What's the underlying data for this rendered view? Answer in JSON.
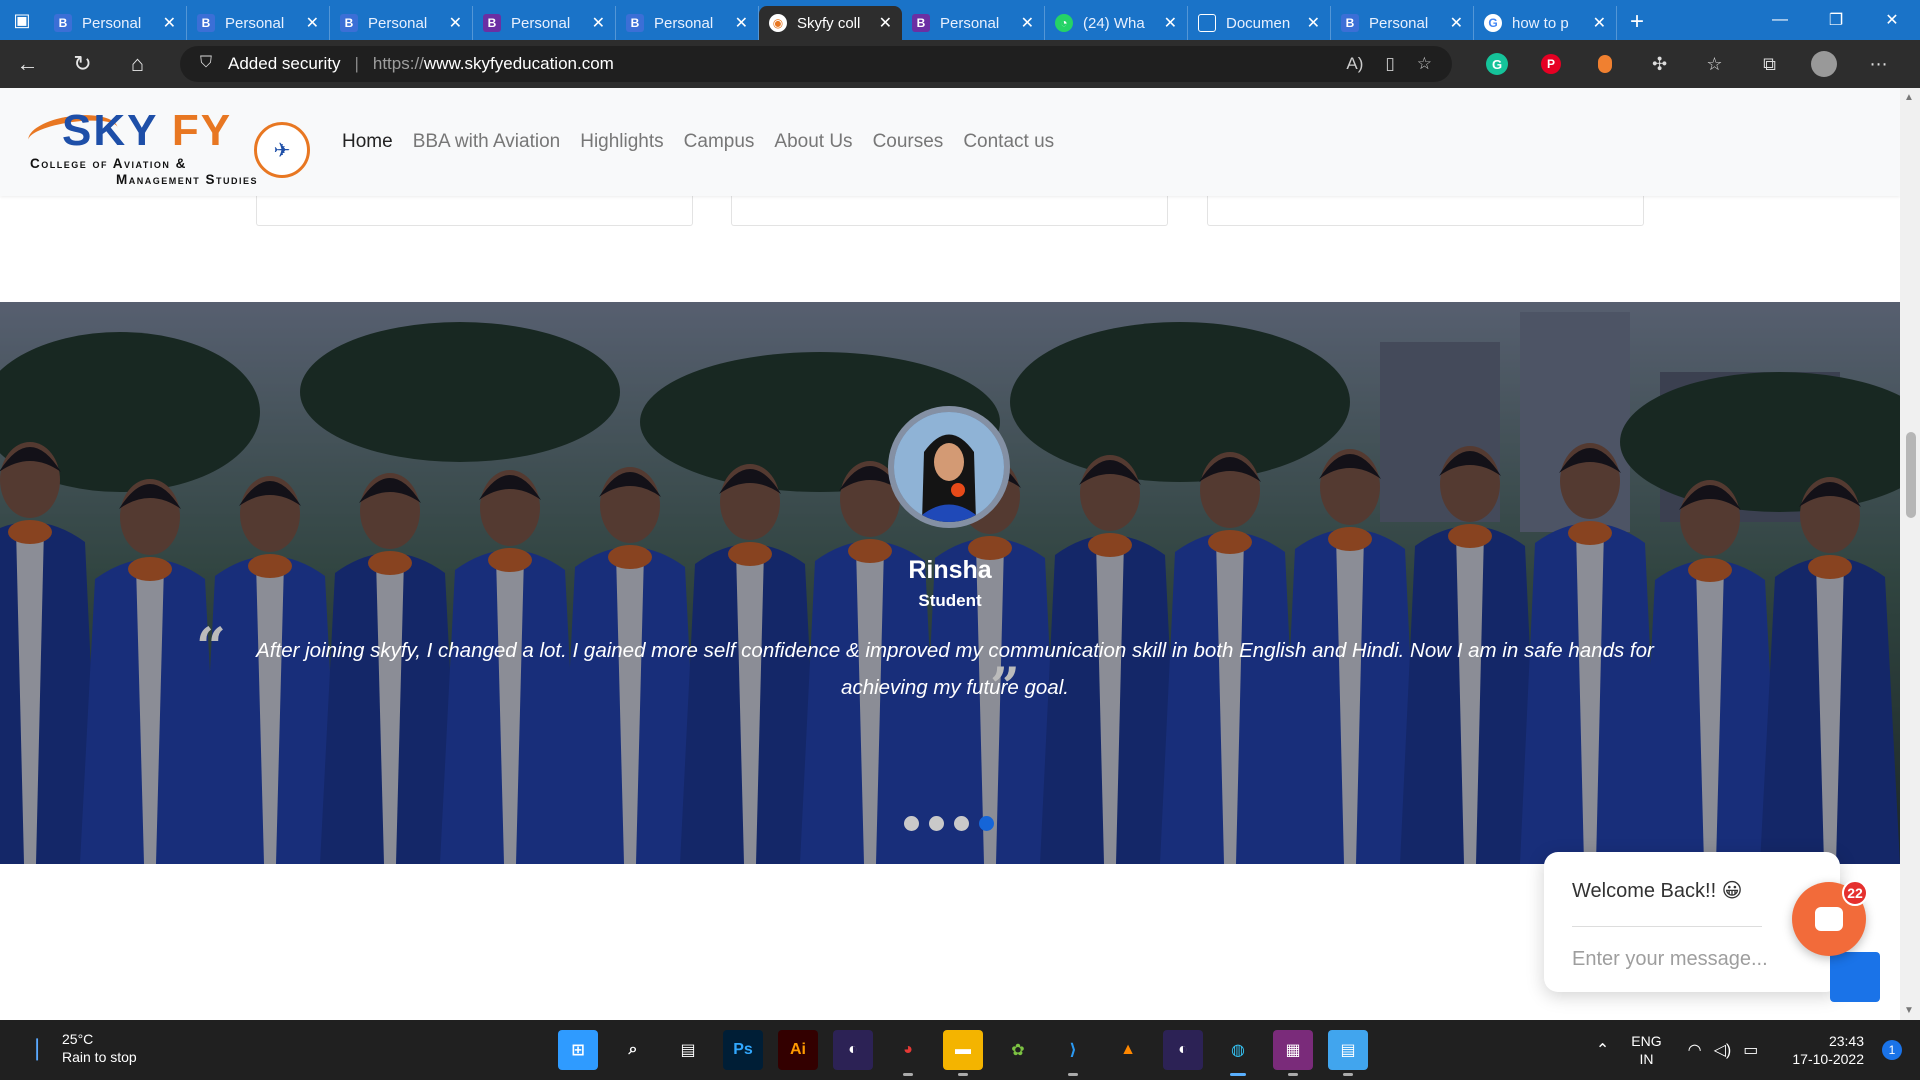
{
  "browser": {
    "tabs": [
      {
        "label": "Personal",
        "icon": "b-blue"
      },
      {
        "label": "Personal",
        "icon": "b-blue"
      },
      {
        "label": "Personal",
        "icon": "b-blue"
      },
      {
        "label": "Personal",
        "icon": "b-purple"
      },
      {
        "label": "Personal",
        "icon": "b-blue"
      },
      {
        "label": "Skyfy coll",
        "icon": "skyfy",
        "active": true
      },
      {
        "label": "Personal",
        "icon": "b-purple"
      },
      {
        "label": "(24) Wha",
        "icon": "whatsapp"
      },
      {
        "label": "Documen",
        "icon": "document"
      },
      {
        "label": "Personal",
        "icon": "b-blue"
      },
      {
        "label": "how to p",
        "icon": "google"
      }
    ],
    "security_label": "Added security",
    "url_protocol": "https://",
    "url_host": "www.skyfyeducation.com"
  },
  "site": {
    "logo_text_sky": "SKY",
    "logo_text_fy": "FY",
    "logo_line1": "College of Aviation &",
    "logo_line2": "Management Studies",
    "nav": [
      {
        "label": "Home",
        "active": true
      },
      {
        "label": "BBA with Aviation"
      },
      {
        "label": "Highlights"
      },
      {
        "label": "Campus"
      },
      {
        "label": "About Us"
      },
      {
        "label": "Courses"
      },
      {
        "label": "Contact us"
      }
    ]
  },
  "testimonial": {
    "name": "Rinsha",
    "role": "Student",
    "quote": "After joining skyfy, I changed a lot. I gained more self confidence & improved my communication skill in both English and Hindi. Now I am in safe hands for achieving my future goal.",
    "slides": 4,
    "active_slide": 4
  },
  "chat": {
    "welcome": "Welcome Back!! 😀",
    "placeholder": "Enter your message...",
    "badge_count": "22"
  },
  "taskbar": {
    "temperature": "25°C",
    "weather": "Rain to stop",
    "lang_top": "ENG",
    "lang_bottom": "IN",
    "time": "23:43",
    "date": "17-10-2022",
    "notification_count": "1",
    "apps": [
      "windows-start",
      "search",
      "task-view",
      "photoshop",
      "illustrator",
      "eclipse",
      "chrome",
      "file-explorer",
      "paint-app",
      "vscode",
      "vlc",
      "eclipse-2",
      "edge",
      "winrar",
      "notepad"
    ]
  }
}
